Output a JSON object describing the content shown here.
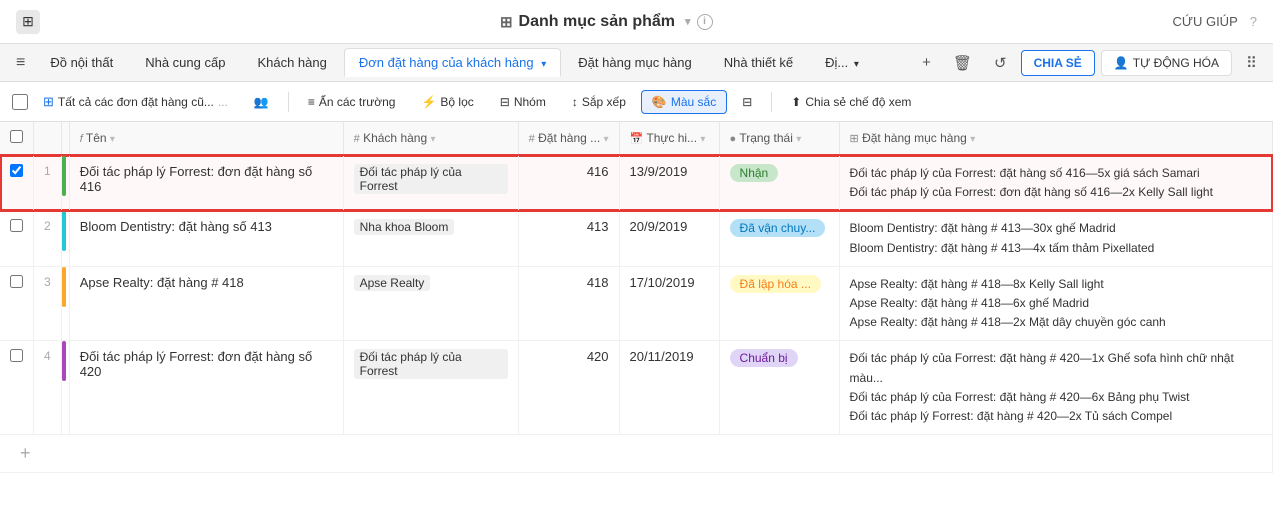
{
  "topbar": {
    "logo": "⊞",
    "title": "Danh mục sản phẩm",
    "title_icon": "⊞",
    "info_icon": "i",
    "help_label": "CỨU GIÚP",
    "help_icon": "?"
  },
  "navbar": {
    "hamburger": "≡",
    "items": [
      {
        "label": "Đồ nội thất",
        "active": false
      },
      {
        "label": "Nhà cung cấp",
        "active": false
      },
      {
        "label": "Khách hàng",
        "active": false
      },
      {
        "label": "Đơn đặt hàng của khách hàng",
        "active": true,
        "dropdown": true
      },
      {
        "label": "Đặt hàng mục hàng",
        "active": false
      },
      {
        "label": "Nhà thiết kế",
        "active": false
      },
      {
        "label": "Đị...",
        "active": false
      }
    ],
    "share_label": "CHIA SẺ",
    "auto_label": "TỰ ĐỘNG HÓA",
    "icons": [
      "+",
      "🗑",
      "↺",
      "⠿"
    ]
  },
  "toolbar": {
    "checkbox_all": false,
    "view_label": "Tất cả các đơn đặt hàng cũ...",
    "view_options": "...",
    "group_icon": "👥",
    "hide_fields_label": "Ẩn các trường",
    "filter_label": "Bộ lọc",
    "group_label": "Nhóm",
    "sort_label": "Sắp xếp",
    "color_label": "Màu sắc",
    "row_height_icon": "⊟",
    "share_view_label": "Chia sẻ chế độ xem"
  },
  "columns": [
    {
      "id": "checkbox",
      "label": ""
    },
    {
      "id": "num",
      "label": ""
    },
    {
      "id": "color",
      "label": ""
    },
    {
      "id": "name",
      "label": "Tên",
      "icon": "f",
      "sortable": true
    },
    {
      "id": "customer",
      "label": "Khách hàng",
      "icon": "#",
      "sortable": true
    },
    {
      "id": "order_num",
      "label": "Đặt hàng ...",
      "icon": "#",
      "sortable": true
    },
    {
      "id": "date",
      "label": "Thực hi...",
      "icon": "📅",
      "sortable": true
    },
    {
      "id": "status",
      "label": "Trạng thái",
      "icon": "●",
      "sortable": true
    },
    {
      "id": "order_items",
      "label": "Đặt hàng mục hàng",
      "icon": "⊞",
      "sortable": true
    }
  ],
  "rows": [
    {
      "num": "1",
      "color": "#4caf50",
      "selected": true,
      "name": "Đối tác pháp lý Forrest: đơn đặt hàng số 416",
      "customer": "Đối tác pháp lý của Forrest",
      "order_num": "416",
      "date": "13/9/2019",
      "status": "Nhận",
      "status_class": "status-nhan",
      "order_items": [
        "Đối tác pháp lý của Forrest: đặt hàng số 416—5x giá sách Samari",
        "Đối tác pháp lý của Forrest: đơn đặt hàng số 416—2x Kelly Sall light"
      ]
    },
    {
      "num": "2",
      "color": "#26c6da",
      "selected": false,
      "name": "Bloom Dentistry: đặt hàng số 413",
      "customer": "Nha khoa Bloom",
      "order_num": "413",
      "date": "20/9/2019",
      "status": "Đã vận chuy...",
      "status_class": "status-van-chuyen",
      "order_items": [
        "Bloom Dentistry: đặt hàng # 413—30x ghế Madrid",
        "Bloom Dentistry: đặt hàng # 413—4x tấm thảm Pixellated"
      ]
    },
    {
      "num": "3",
      "color": "#ffa726",
      "selected": false,
      "name": "Apse Realty: đặt hàng # 418",
      "customer": "Apse Realty",
      "order_num": "418",
      "date": "17/10/2019",
      "status": "Đã lập hóa ...",
      "status_class": "status-lap-hoa",
      "order_items": [
        "Apse Realty: đặt hàng # 418—8x Kelly Sall light",
        "Apse Realty: đặt hàng # 418—6x ghế Madrid",
        "Apse Realty: đặt hàng # 418—2x Mặt dây chuyền góc canh"
      ]
    },
    {
      "num": "4",
      "color": "#ab47bc",
      "selected": false,
      "name": "Đối tác pháp lý Forrest: đơn đặt hàng số 420",
      "customer": "Đối tác pháp lý của Forrest",
      "order_num": "420",
      "date": "20/11/2019",
      "status": "Chuẩn bị",
      "status_class": "status-chuan-bi",
      "order_items": [
        "Đối tác pháp lý của Forrest: đặt hàng # 420—1x Ghế sofa hình chữ nhật màu...",
        "Đối tác pháp lý của Forrest: đặt hàng # 420—6x Bảng phụ Twist",
        "Đối tác pháp lý Forrest: đặt hàng # 420—2x Tủ sách Compel"
      ]
    }
  ],
  "add_row_label": "+"
}
